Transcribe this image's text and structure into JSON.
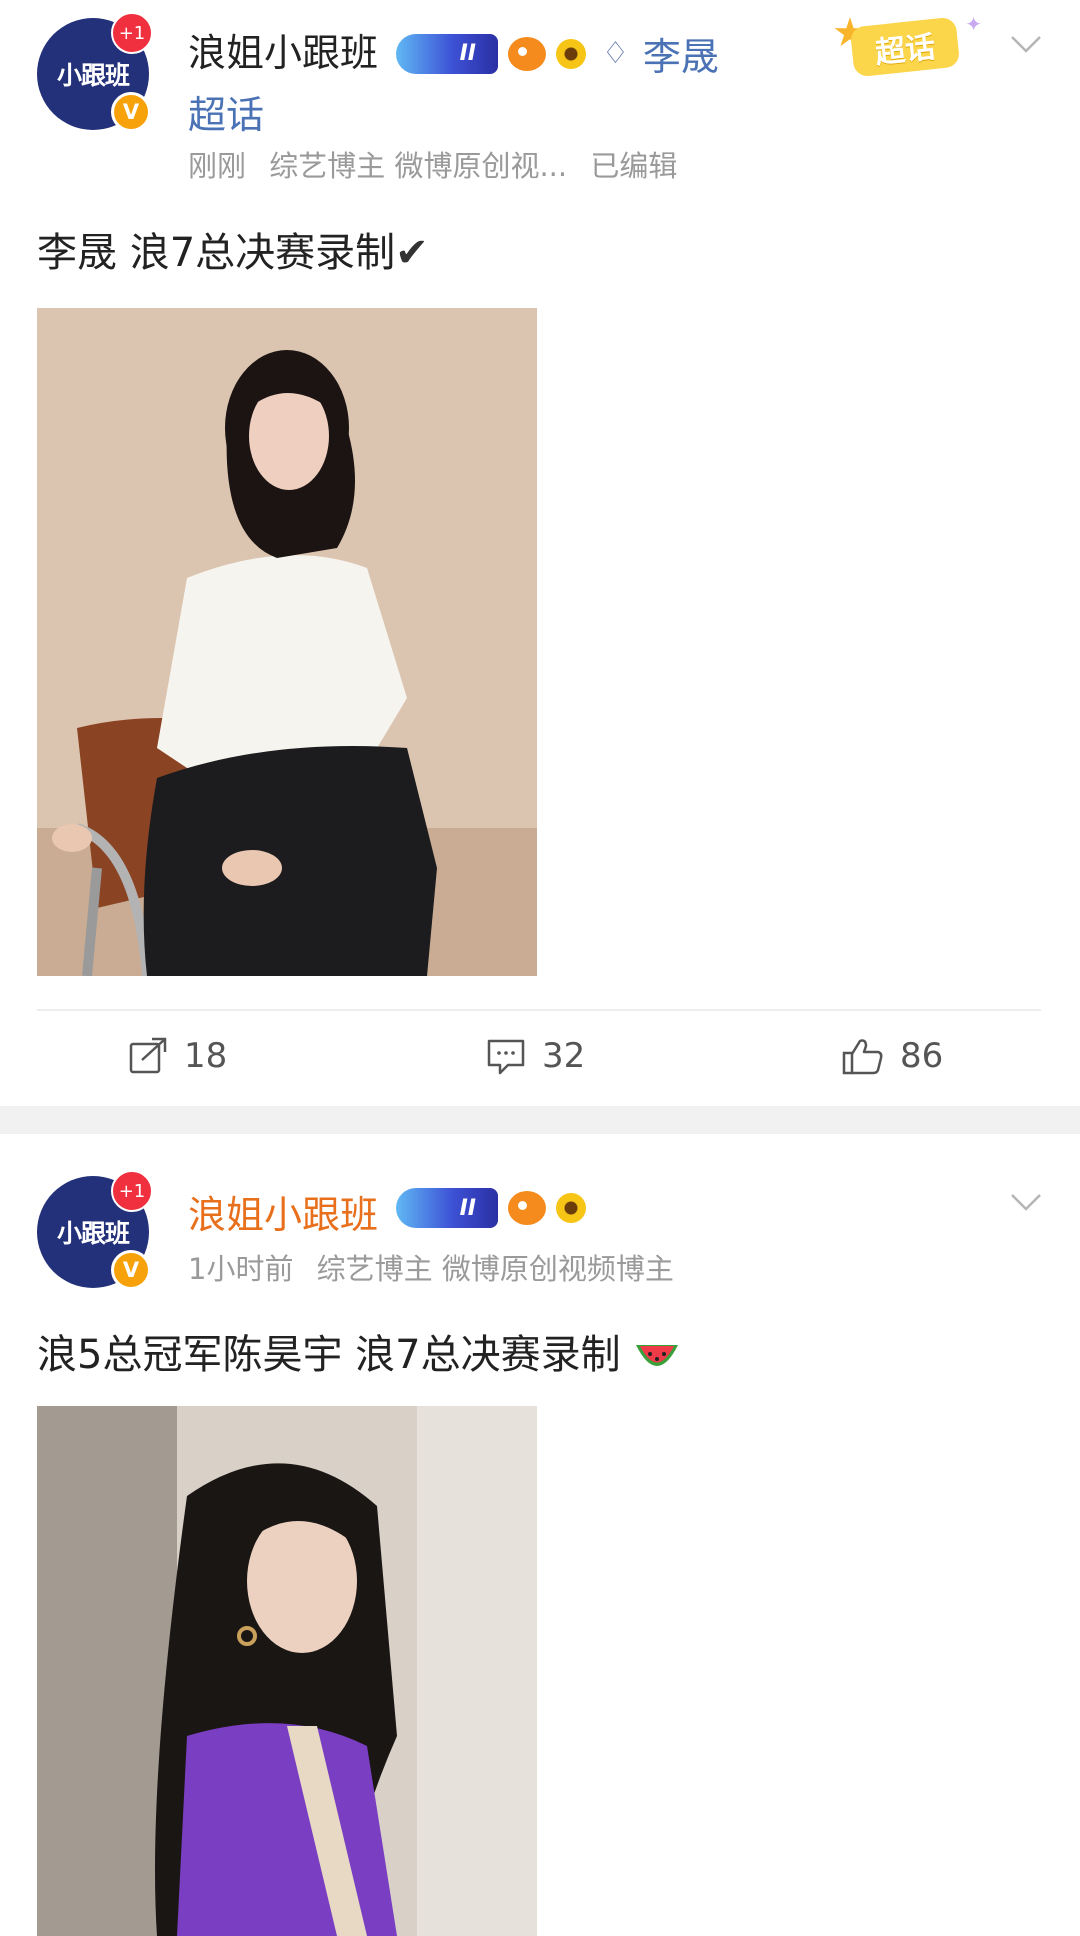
{
  "posts": [
    {
      "author": {
        "name": "浪姐小跟班",
        "avatar_text": "小跟班",
        "avatar_plus": "+1",
        "verified_mark": "V",
        "vip_badge": "II"
      },
      "topic": {
        "name": "李晟",
        "suffix": "超话",
        "super_badge": "超话"
      },
      "meta": {
        "time": "刚刚",
        "tags": "综艺博主 微博原创视...",
        "edited": "已编辑"
      },
      "content": {
        "text": "李晟  浪7总决赛录制",
        "emoji": "✔"
      },
      "actions": {
        "repost": "18",
        "comment": "32",
        "like": "86"
      }
    },
    {
      "author": {
        "name": "浪姐小跟班",
        "avatar_text": "小跟班",
        "avatar_plus": "+1",
        "verified_mark": "V",
        "vip_badge": "II"
      },
      "meta": {
        "time": "1小时前",
        "tags": "综艺博主 微博原创视频博主"
      },
      "content": {
        "text": "浪5总冠军陈昊宇  浪7总决赛录制"
      }
    }
  ],
  "colors": {
    "topic_link": "#4a72b5",
    "username_highlight": "#e8701c",
    "meta_gray": "#9a9a9a",
    "avatar_bg": "#23307a"
  },
  "icons": {
    "repost": "repost-icon",
    "comment": "comment-icon",
    "like": "thumbs-up-icon",
    "more": "chevron-down-icon",
    "topic": "diamond-icon"
  }
}
